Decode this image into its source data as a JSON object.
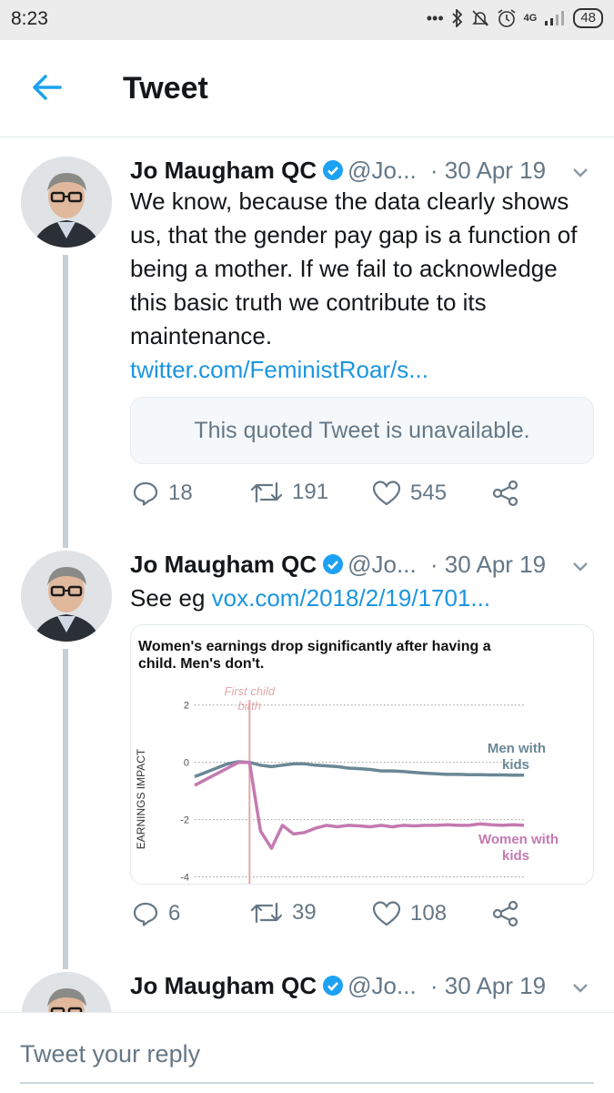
{
  "status_bar": {
    "time": "8:23",
    "network": "4G",
    "battery": "48"
  },
  "header": {
    "title": "Tweet"
  },
  "tweets": [
    {
      "name": "Jo Maugham QC",
      "handle": "@Jo...",
      "date": "· 30 Apr 19",
      "text": "We know, because the data clearly shows us, that the gender pay gap is a function of being a mother. If we fail to acknowledge this basic truth we contribute to its maintenance.",
      "link": "twitter.com/FeministRoar/s...",
      "quoted": "This quoted Tweet is unavailable.",
      "replies": "18",
      "retweets": "191",
      "likes": "545"
    },
    {
      "name": "Jo Maugham QC",
      "handle": "@Jo...",
      "date": "· 30 Apr 19",
      "text_prefix": "See eg",
      "link": "vox.com/2018/2/19/1701...",
      "replies": "6",
      "retweets": "39",
      "likes": "108"
    },
    {
      "name": "Jo Maugham QC",
      "handle": "@Jo...",
      "date": "· 30 Apr 19"
    }
  ],
  "chart_data": {
    "type": "line",
    "title": "Women's earnings drop significantly after having a child. Men's don't.",
    "ylabel": "EARNINGS IMPACT",
    "yticks": [
      "2",
      "0",
      "-2",
      "-4"
    ],
    "ylim": [
      -4.3,
      2.5
    ],
    "xlim": [
      0,
      30
    ],
    "annotation": {
      "label": "First child birth",
      "x": 5
    },
    "grid": true,
    "colors": {
      "men": "#6a8796",
      "women": "#c47ab0",
      "birth": "#e3a9a9"
    },
    "series": [
      {
        "name": "Men with kids",
        "x": [
          0,
          1,
          2,
          3,
          4,
          5,
          6,
          7,
          8,
          9,
          10,
          11,
          12,
          13,
          14,
          15,
          16,
          17,
          18,
          19,
          20,
          21,
          22,
          23,
          24,
          25,
          26,
          27,
          28,
          29,
          30
        ],
        "values": [
          -0.5,
          -0.35,
          -0.2,
          -0.05,
          0.02,
          0.0,
          -0.1,
          -0.15,
          -0.1,
          -0.05,
          -0.05,
          -0.1,
          -0.12,
          -0.15,
          -0.2,
          -0.22,
          -0.25,
          -0.3,
          -0.3,
          -0.32,
          -0.35,
          -0.38,
          -0.4,
          -0.42,
          -0.42,
          -0.43,
          -0.43,
          -0.44,
          -0.44,
          -0.45,
          -0.45
        ]
      },
      {
        "name": "Women with kids",
        "x": [
          0,
          1,
          2,
          3,
          4,
          5,
          6,
          7,
          8,
          9,
          10,
          11,
          12,
          13,
          14,
          15,
          16,
          17,
          18,
          19,
          20,
          21,
          22,
          23,
          24,
          25,
          26,
          27,
          28,
          29,
          30
        ],
        "values": [
          -0.8,
          -0.6,
          -0.4,
          -0.2,
          0.0,
          0.0,
          -2.4,
          -3.0,
          -2.2,
          -2.5,
          -2.45,
          -2.3,
          -2.2,
          -2.25,
          -2.2,
          -2.22,
          -2.25,
          -2.2,
          -2.25,
          -2.2,
          -2.22,
          -2.2,
          -2.2,
          -2.18,
          -2.2,
          -2.2,
          -2.15,
          -2.18,
          -2.2,
          -2.18,
          -2.2
        ]
      }
    ]
  }
}
